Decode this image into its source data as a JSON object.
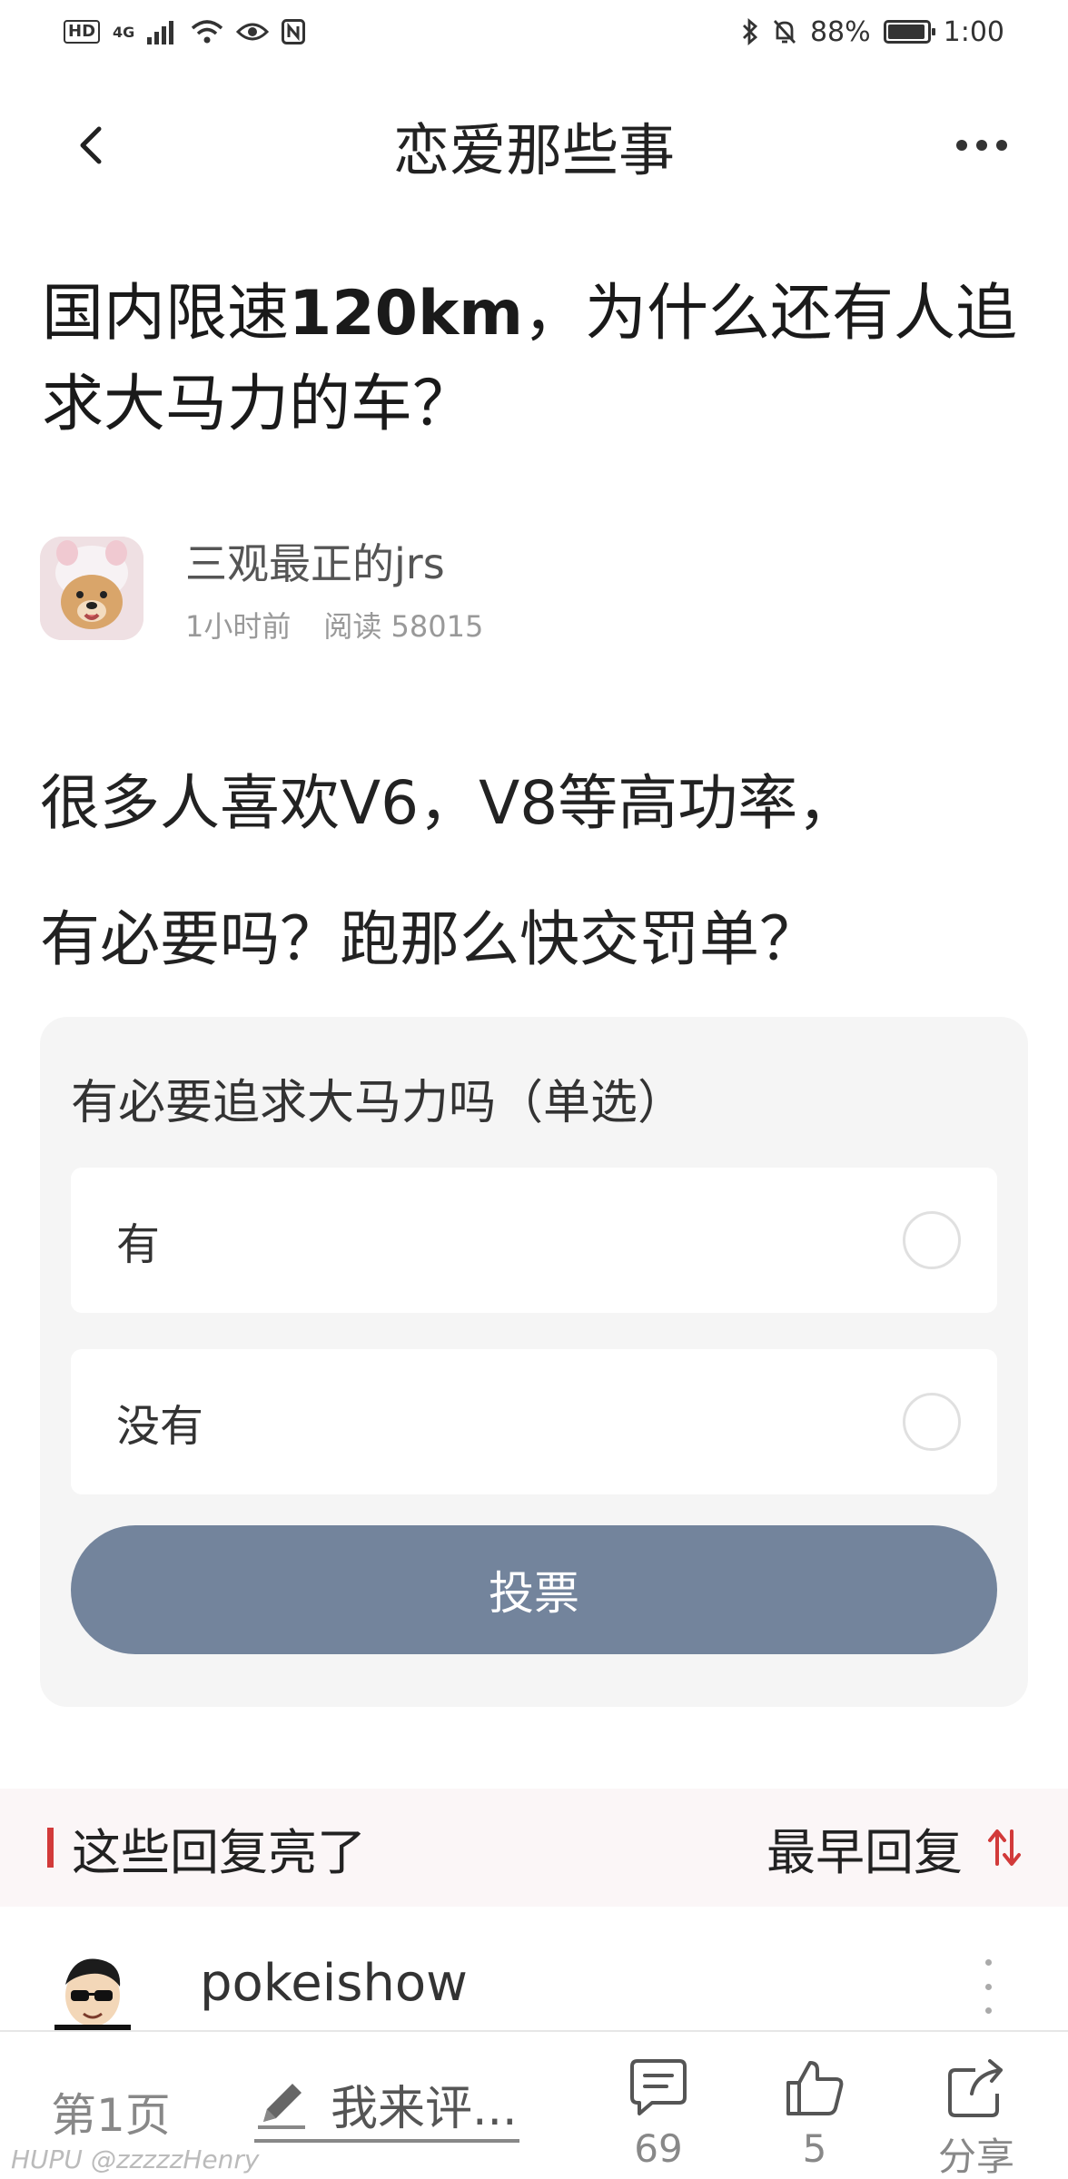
{
  "status_bar": {
    "hd": "HD",
    "signal": "4G",
    "battery": "88%",
    "time": "1:00"
  },
  "nav": {
    "title": "恋爱那些事"
  },
  "post": {
    "title_part1": "国内限速",
    "title_bold": "120km",
    "title_part2": "，为什么还有人追求大马力的车？",
    "author_name": "三观最正的jrs",
    "time_ago": "1小时前",
    "reads": "阅读 58015",
    "body_line1": "很多人喜欢V6，V8等高功率，",
    "body_line2": "有必要吗？跑那么快交罚单？"
  },
  "poll": {
    "title": "有必要追求大马力吗（单选）",
    "options": [
      {
        "label": "有"
      },
      {
        "label": "没有"
      }
    ],
    "vote_label": "投票"
  },
  "replies": {
    "header": "这些回复亮了",
    "sort_label": "最早回复",
    "first_reply_user": "pokeishow"
  },
  "bottom_bar": {
    "page_label": "第1页",
    "comment_label": "我来评...",
    "comments_count": "69",
    "likes_count": "5",
    "share_label": "分享"
  },
  "watermark": "HUPU @zzzzzHenry",
  "colors": {
    "vote_button": "#73849c",
    "accent_red": "#d23a3a",
    "poll_bg": "#f5f5f5"
  }
}
